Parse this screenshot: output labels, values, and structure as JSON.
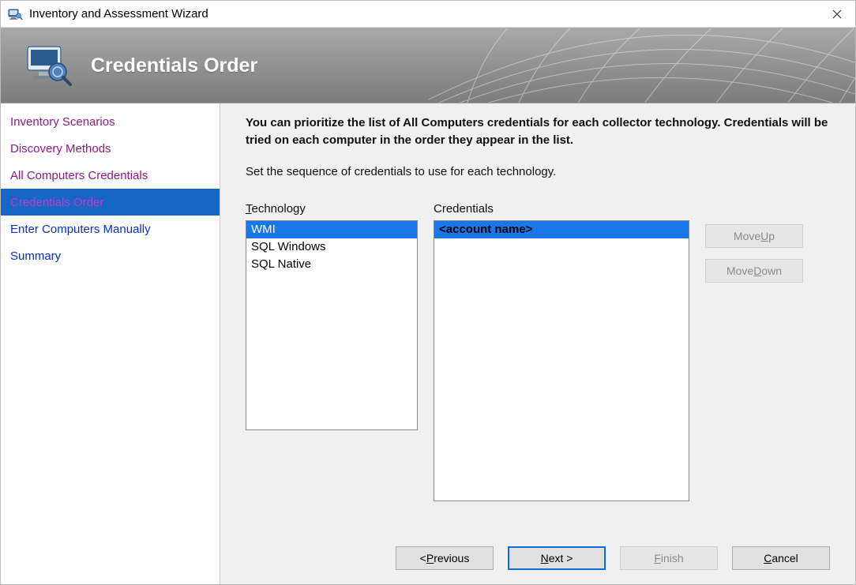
{
  "title": "Inventory and Assessment Wizard",
  "banner": {
    "title": "Credentials Order"
  },
  "sidebar": {
    "items": [
      {
        "label": "Inventory Scenarios",
        "state": "visited"
      },
      {
        "label": "Discovery Methods",
        "state": "visited"
      },
      {
        "label": "All Computers Credentials",
        "state": "visited"
      },
      {
        "label": "Credentials Order",
        "state": "selected"
      },
      {
        "label": "Enter Computers Manually",
        "state": ""
      },
      {
        "label": "Summary",
        "state": ""
      }
    ]
  },
  "main": {
    "intro_bold": "You can prioritize the list of All Computers credentials for each collector technology. Credentials will be tried on each computer in the order they appear in the list.",
    "intro_sub": "Set the sequence of credentials to use for each technology.",
    "technology_label_pre": "T",
    "technology_label_post": "echnology",
    "credentials_label_pre": "C",
    "credentials_label_post": "redentials",
    "technology_items": [
      "WMI",
      "SQL Windows",
      "SQL Native"
    ],
    "technology_selected_index": 0,
    "credentials_items": [
      "<account name>"
    ],
    "credentials_selected_index": 0,
    "move_up_pre": "Move ",
    "move_up_ul": "U",
    "move_up_post": "p",
    "move_down_pre": "Move ",
    "move_down_ul": "D",
    "move_down_post": "own"
  },
  "footer": {
    "previous_pre": "< ",
    "previous_ul": "P",
    "previous_post": "revious",
    "next_ul": "N",
    "next_post": "ext >",
    "finish_ul": "F",
    "finish_post": "inish",
    "cancel_ul": "C",
    "cancel_post": "ancel"
  }
}
